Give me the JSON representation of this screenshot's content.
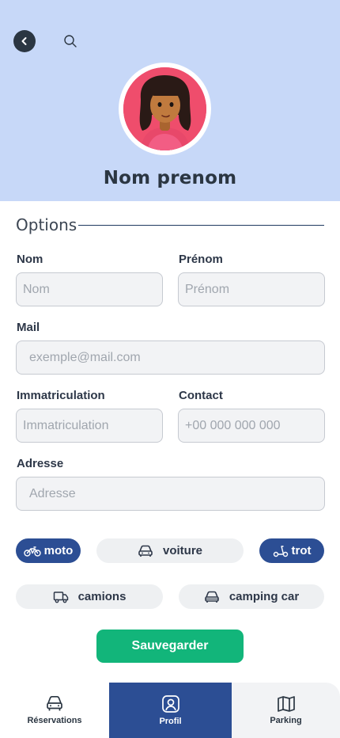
{
  "header": {
    "background": "#c7d8f8",
    "profile_name": "Nom prenom",
    "back_icon": "chevron-left-icon",
    "search_icon": "search-icon"
  },
  "options": {
    "title": "Options"
  },
  "form": {
    "nom": {
      "label": "Nom",
      "placeholder": "Nom"
    },
    "prenom": {
      "label": "Prénom",
      "placeholder": "Prénom"
    },
    "mail": {
      "label": "Mail",
      "placeholder": "exemple@mail.com"
    },
    "immatriculation": {
      "label": "Immatriculation",
      "placeholder": "Immatriculation"
    },
    "contact": {
      "label": "Contact",
      "placeholder": "+00 000 000 000"
    },
    "adresse": {
      "label": "Adresse",
      "placeholder": "Adresse"
    }
  },
  "vehicles": [
    {
      "label": "moto",
      "icon": "motorbike-icon",
      "selected": true
    },
    {
      "label": "voiture",
      "icon": "car-icon",
      "selected": false
    },
    {
      "label": "trot",
      "icon": "scooter-icon",
      "selected": true
    },
    {
      "label": "camions",
      "icon": "truck-icon",
      "selected": false
    },
    {
      "label": "camping car",
      "icon": "camper-icon",
      "selected": false
    }
  ],
  "save_button": {
    "label": "Sauvegarder",
    "color": "#12b57a"
  },
  "nav": [
    {
      "label": "Réservations",
      "icon": "car-front-icon",
      "active": false
    },
    {
      "label": "Profil",
      "icon": "profile-icon",
      "active": true
    },
    {
      "label": "Parking",
      "icon": "map-icon",
      "active": false
    }
  ],
  "colors": {
    "accent": "#2c4e94",
    "success": "#12b57a",
    "text": "#2d3748"
  }
}
